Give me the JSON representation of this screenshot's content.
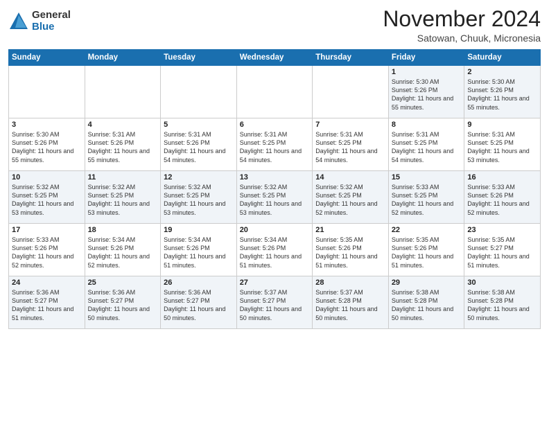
{
  "logo": {
    "general": "General",
    "blue": "Blue"
  },
  "header": {
    "month": "November 2024",
    "location": "Satowan, Chuuk, Micronesia"
  },
  "days_of_week": [
    "Sunday",
    "Monday",
    "Tuesday",
    "Wednesday",
    "Thursday",
    "Friday",
    "Saturday"
  ],
  "weeks": [
    [
      {
        "day": "",
        "info": ""
      },
      {
        "day": "",
        "info": ""
      },
      {
        "day": "",
        "info": ""
      },
      {
        "day": "",
        "info": ""
      },
      {
        "day": "",
        "info": ""
      },
      {
        "day": "1",
        "info": "Sunrise: 5:30 AM\nSunset: 5:26 PM\nDaylight: 11 hours and 55 minutes."
      },
      {
        "day": "2",
        "info": "Sunrise: 5:30 AM\nSunset: 5:26 PM\nDaylight: 11 hours and 55 minutes."
      }
    ],
    [
      {
        "day": "3",
        "info": "Sunrise: 5:30 AM\nSunset: 5:26 PM\nDaylight: 11 hours and 55 minutes."
      },
      {
        "day": "4",
        "info": "Sunrise: 5:31 AM\nSunset: 5:26 PM\nDaylight: 11 hours and 55 minutes."
      },
      {
        "day": "5",
        "info": "Sunrise: 5:31 AM\nSunset: 5:26 PM\nDaylight: 11 hours and 54 minutes."
      },
      {
        "day": "6",
        "info": "Sunrise: 5:31 AM\nSunset: 5:25 PM\nDaylight: 11 hours and 54 minutes."
      },
      {
        "day": "7",
        "info": "Sunrise: 5:31 AM\nSunset: 5:25 PM\nDaylight: 11 hours and 54 minutes."
      },
      {
        "day": "8",
        "info": "Sunrise: 5:31 AM\nSunset: 5:25 PM\nDaylight: 11 hours and 54 minutes."
      },
      {
        "day": "9",
        "info": "Sunrise: 5:31 AM\nSunset: 5:25 PM\nDaylight: 11 hours and 53 minutes."
      }
    ],
    [
      {
        "day": "10",
        "info": "Sunrise: 5:32 AM\nSunset: 5:25 PM\nDaylight: 11 hours and 53 minutes."
      },
      {
        "day": "11",
        "info": "Sunrise: 5:32 AM\nSunset: 5:25 PM\nDaylight: 11 hours and 53 minutes."
      },
      {
        "day": "12",
        "info": "Sunrise: 5:32 AM\nSunset: 5:25 PM\nDaylight: 11 hours and 53 minutes."
      },
      {
        "day": "13",
        "info": "Sunrise: 5:32 AM\nSunset: 5:25 PM\nDaylight: 11 hours and 53 minutes."
      },
      {
        "day": "14",
        "info": "Sunrise: 5:32 AM\nSunset: 5:25 PM\nDaylight: 11 hours and 52 minutes."
      },
      {
        "day": "15",
        "info": "Sunrise: 5:33 AM\nSunset: 5:25 PM\nDaylight: 11 hours and 52 minutes."
      },
      {
        "day": "16",
        "info": "Sunrise: 5:33 AM\nSunset: 5:26 PM\nDaylight: 11 hours and 52 minutes."
      }
    ],
    [
      {
        "day": "17",
        "info": "Sunrise: 5:33 AM\nSunset: 5:26 PM\nDaylight: 11 hours and 52 minutes."
      },
      {
        "day": "18",
        "info": "Sunrise: 5:34 AM\nSunset: 5:26 PM\nDaylight: 11 hours and 52 minutes."
      },
      {
        "day": "19",
        "info": "Sunrise: 5:34 AM\nSunset: 5:26 PM\nDaylight: 11 hours and 51 minutes."
      },
      {
        "day": "20",
        "info": "Sunrise: 5:34 AM\nSunset: 5:26 PM\nDaylight: 11 hours and 51 minutes."
      },
      {
        "day": "21",
        "info": "Sunrise: 5:35 AM\nSunset: 5:26 PM\nDaylight: 11 hours and 51 minutes."
      },
      {
        "day": "22",
        "info": "Sunrise: 5:35 AM\nSunset: 5:26 PM\nDaylight: 11 hours and 51 minutes."
      },
      {
        "day": "23",
        "info": "Sunrise: 5:35 AM\nSunset: 5:27 PM\nDaylight: 11 hours and 51 minutes."
      }
    ],
    [
      {
        "day": "24",
        "info": "Sunrise: 5:36 AM\nSunset: 5:27 PM\nDaylight: 11 hours and 51 minutes."
      },
      {
        "day": "25",
        "info": "Sunrise: 5:36 AM\nSunset: 5:27 PM\nDaylight: 11 hours and 50 minutes."
      },
      {
        "day": "26",
        "info": "Sunrise: 5:36 AM\nSunset: 5:27 PM\nDaylight: 11 hours and 50 minutes."
      },
      {
        "day": "27",
        "info": "Sunrise: 5:37 AM\nSunset: 5:27 PM\nDaylight: 11 hours and 50 minutes."
      },
      {
        "day": "28",
        "info": "Sunrise: 5:37 AM\nSunset: 5:28 PM\nDaylight: 11 hours and 50 minutes."
      },
      {
        "day": "29",
        "info": "Sunrise: 5:38 AM\nSunset: 5:28 PM\nDaylight: 11 hours and 50 minutes."
      },
      {
        "day": "30",
        "info": "Sunrise: 5:38 AM\nSunset: 5:28 PM\nDaylight: 11 hours and 50 minutes."
      }
    ]
  ]
}
